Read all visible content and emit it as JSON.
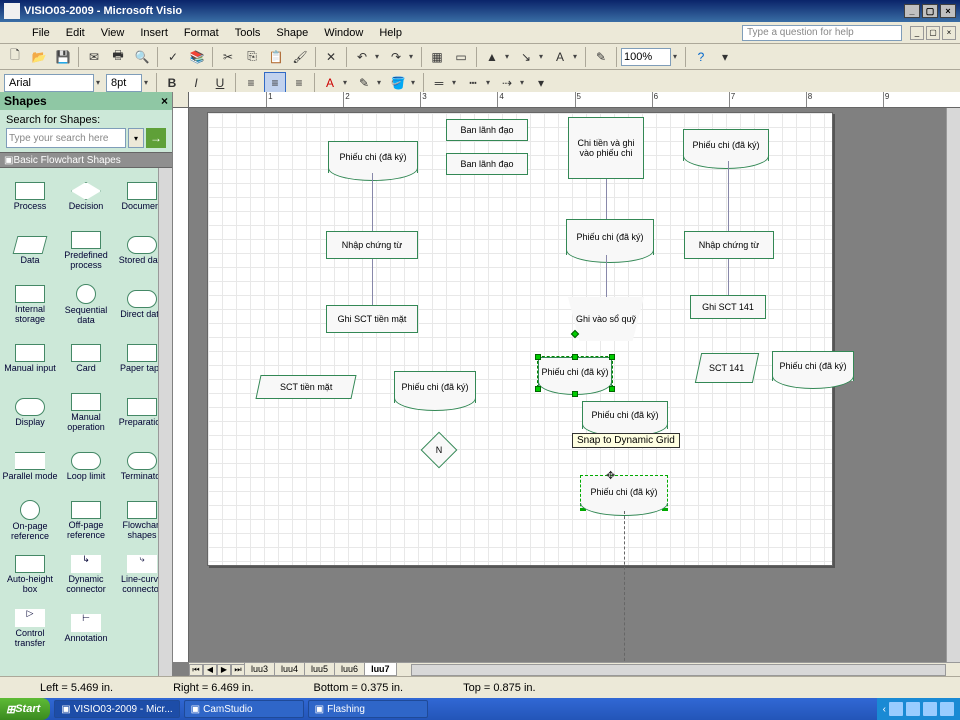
{
  "titlebar": {
    "title": "VISIO03-2009 - Microsoft Visio"
  },
  "menu": {
    "file": "File",
    "edit": "Edit",
    "view": "View",
    "insert": "Insert",
    "format": "Format",
    "tools": "Tools",
    "shape": "Shape",
    "window": "Window",
    "help": "Help",
    "question": "Type a question for help"
  },
  "toolbar": {
    "zoom": "100%",
    "font": "Arial",
    "size": "8pt"
  },
  "shapes": {
    "title": "Shapes",
    "search_label": "Search for Shapes:",
    "search_placeholder": "Type your search here",
    "category": "Basic Flowchart Shapes",
    "items": [
      {
        "label": "Process"
      },
      {
        "label": "Decision"
      },
      {
        "label": "Document"
      },
      {
        "label": "Data"
      },
      {
        "label": "Predefined process"
      },
      {
        "label": "Stored data"
      },
      {
        "label": "Internal storage"
      },
      {
        "label": "Sequential data"
      },
      {
        "label": "Direct data"
      },
      {
        "label": "Manual input"
      },
      {
        "label": "Card"
      },
      {
        "label": "Paper tape"
      },
      {
        "label": "Display"
      },
      {
        "label": "Manual operation"
      },
      {
        "label": "Preparation"
      },
      {
        "label": "Parallel mode"
      },
      {
        "label": "Loop limit"
      },
      {
        "label": "Terminator"
      },
      {
        "label": "On-page reference"
      },
      {
        "label": "Off-page reference"
      },
      {
        "label": "Flowchart shapes"
      },
      {
        "label": "Auto-height box"
      },
      {
        "label": "Dynamic connector"
      },
      {
        "label": "Line-curve connector"
      },
      {
        "label": "Control transfer"
      },
      {
        "label": "Annotation"
      }
    ]
  },
  "canvas": {
    "shapes": {
      "s1": "Phiếu chi (đã ký)",
      "s2": "Ban lãnh đạo",
      "s3": "Ban lãnh đạo",
      "s4": "Chi tiền và ghi vào phiếu chi",
      "s5": "Phiếu chi (đã ký)",
      "s6": "Nhập chứng từ",
      "s7": "Phiếu chi (đã ký)",
      "s8": "Nhập chứng từ",
      "s9": "Ghi SCT tiền mặt",
      "s10": "Ghi vào sổ quỹ",
      "s11": "Ghi SCT 141",
      "s12": "SCT tiền mặt",
      "s13": "Phiếu chi (đã ký)",
      "s14": "Phiếu chi (đã ký)",
      "s15": "SCT 141",
      "s16": "Phiếu chi (đã ký)",
      "s17": "N",
      "s18": "Phiếu chi (đã ký)",
      "tooltip": "Snap to Dynamic Grid"
    },
    "tabs": [
      "luu3",
      "luu4",
      "luu5",
      "luu6",
      "luu7"
    ],
    "active_tab": "luu7",
    "ruler": [
      "1",
      "2",
      "3",
      "4",
      "5",
      "6",
      "7",
      "8",
      "9"
    ]
  },
  "status": {
    "left": "Left = 5.469 in.",
    "right": "Right = 6.469 in.",
    "bottom": "Bottom = 0.375 in.",
    "top": "Top = 0.875 in."
  },
  "taskbar": {
    "start": "Start",
    "items": [
      "VISIO03-2009 - Micr...",
      "CamStudio",
      "Flashing"
    ]
  }
}
